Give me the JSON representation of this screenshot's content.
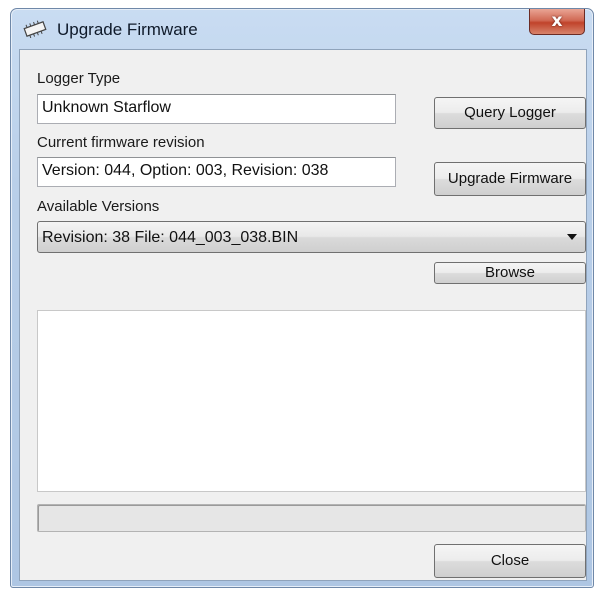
{
  "window": {
    "title": "Upgrade Firmware",
    "close_glyph": "x",
    "icon": "firmware-chip-icon"
  },
  "logger_type": {
    "label": "Logger Type",
    "value": "Unknown Starflow"
  },
  "current_firmware": {
    "label": "Current firmware revision",
    "value": "Version: 044, Option: 003, Revision: 038"
  },
  "available_versions": {
    "label": "Available Versions",
    "selected": "Revision: 38 File: 044_003_038.BIN"
  },
  "buttons": {
    "query_logger": "Query Logger",
    "upgrade_firmware": "Upgrade Firmware",
    "browse": "Browse",
    "close": "Close"
  },
  "progress": {
    "value": 0
  },
  "colors": {
    "close_button": "#c0432b",
    "titlebar": "#c9dcf2",
    "client_background": "#f0f0f0"
  }
}
